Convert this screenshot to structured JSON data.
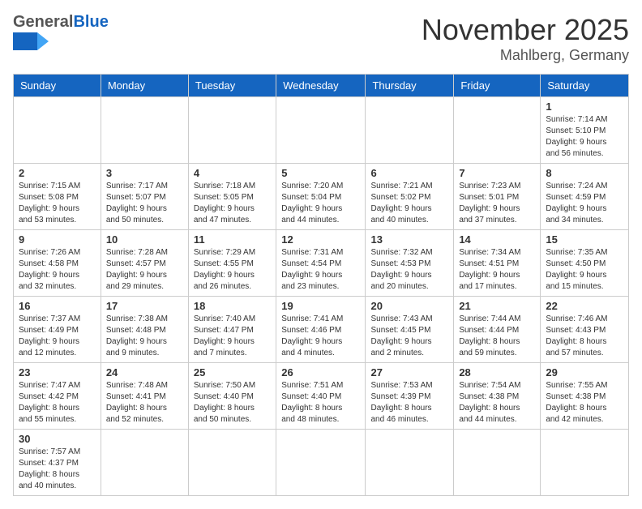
{
  "header": {
    "logo_general": "General",
    "logo_blue": "Blue",
    "main_title": "November 2025",
    "sub_title": "Mahlberg, Germany"
  },
  "days_of_week": [
    "Sunday",
    "Monday",
    "Tuesday",
    "Wednesday",
    "Thursday",
    "Friday",
    "Saturday"
  ],
  "weeks": [
    [
      {
        "day": "",
        "info": ""
      },
      {
        "day": "",
        "info": ""
      },
      {
        "day": "",
        "info": ""
      },
      {
        "day": "",
        "info": ""
      },
      {
        "day": "",
        "info": ""
      },
      {
        "day": "",
        "info": ""
      },
      {
        "day": "1",
        "info": "Sunrise: 7:14 AM\nSunset: 5:10 PM\nDaylight: 9 hours\nand 56 minutes."
      }
    ],
    [
      {
        "day": "2",
        "info": "Sunrise: 7:15 AM\nSunset: 5:08 PM\nDaylight: 9 hours\nand 53 minutes."
      },
      {
        "day": "3",
        "info": "Sunrise: 7:17 AM\nSunset: 5:07 PM\nDaylight: 9 hours\nand 50 minutes."
      },
      {
        "day": "4",
        "info": "Sunrise: 7:18 AM\nSunset: 5:05 PM\nDaylight: 9 hours\nand 47 minutes."
      },
      {
        "day": "5",
        "info": "Sunrise: 7:20 AM\nSunset: 5:04 PM\nDaylight: 9 hours\nand 44 minutes."
      },
      {
        "day": "6",
        "info": "Sunrise: 7:21 AM\nSunset: 5:02 PM\nDaylight: 9 hours\nand 40 minutes."
      },
      {
        "day": "7",
        "info": "Sunrise: 7:23 AM\nSunset: 5:01 PM\nDaylight: 9 hours\nand 37 minutes."
      },
      {
        "day": "8",
        "info": "Sunrise: 7:24 AM\nSunset: 4:59 PM\nDaylight: 9 hours\nand 34 minutes."
      }
    ],
    [
      {
        "day": "9",
        "info": "Sunrise: 7:26 AM\nSunset: 4:58 PM\nDaylight: 9 hours\nand 32 minutes."
      },
      {
        "day": "10",
        "info": "Sunrise: 7:28 AM\nSunset: 4:57 PM\nDaylight: 9 hours\nand 29 minutes."
      },
      {
        "day": "11",
        "info": "Sunrise: 7:29 AM\nSunset: 4:55 PM\nDaylight: 9 hours\nand 26 minutes."
      },
      {
        "day": "12",
        "info": "Sunrise: 7:31 AM\nSunset: 4:54 PM\nDaylight: 9 hours\nand 23 minutes."
      },
      {
        "day": "13",
        "info": "Sunrise: 7:32 AM\nSunset: 4:53 PM\nDaylight: 9 hours\nand 20 minutes."
      },
      {
        "day": "14",
        "info": "Sunrise: 7:34 AM\nSunset: 4:51 PM\nDaylight: 9 hours\nand 17 minutes."
      },
      {
        "day": "15",
        "info": "Sunrise: 7:35 AM\nSunset: 4:50 PM\nDaylight: 9 hours\nand 15 minutes."
      }
    ],
    [
      {
        "day": "16",
        "info": "Sunrise: 7:37 AM\nSunset: 4:49 PM\nDaylight: 9 hours\nand 12 minutes."
      },
      {
        "day": "17",
        "info": "Sunrise: 7:38 AM\nSunset: 4:48 PM\nDaylight: 9 hours\nand 9 minutes."
      },
      {
        "day": "18",
        "info": "Sunrise: 7:40 AM\nSunset: 4:47 PM\nDaylight: 9 hours\nand 7 minutes."
      },
      {
        "day": "19",
        "info": "Sunrise: 7:41 AM\nSunset: 4:46 PM\nDaylight: 9 hours\nand 4 minutes."
      },
      {
        "day": "20",
        "info": "Sunrise: 7:43 AM\nSunset: 4:45 PM\nDaylight: 9 hours\nand 2 minutes."
      },
      {
        "day": "21",
        "info": "Sunrise: 7:44 AM\nSunset: 4:44 PM\nDaylight: 8 hours\nand 59 minutes."
      },
      {
        "day": "22",
        "info": "Sunrise: 7:46 AM\nSunset: 4:43 PM\nDaylight: 8 hours\nand 57 minutes."
      }
    ],
    [
      {
        "day": "23",
        "info": "Sunrise: 7:47 AM\nSunset: 4:42 PM\nDaylight: 8 hours\nand 55 minutes."
      },
      {
        "day": "24",
        "info": "Sunrise: 7:48 AM\nSunset: 4:41 PM\nDaylight: 8 hours\nand 52 minutes."
      },
      {
        "day": "25",
        "info": "Sunrise: 7:50 AM\nSunset: 4:40 PM\nDaylight: 8 hours\nand 50 minutes."
      },
      {
        "day": "26",
        "info": "Sunrise: 7:51 AM\nSunset: 4:40 PM\nDaylight: 8 hours\nand 48 minutes."
      },
      {
        "day": "27",
        "info": "Sunrise: 7:53 AM\nSunset: 4:39 PM\nDaylight: 8 hours\nand 46 minutes."
      },
      {
        "day": "28",
        "info": "Sunrise: 7:54 AM\nSunset: 4:38 PM\nDaylight: 8 hours\nand 44 minutes."
      },
      {
        "day": "29",
        "info": "Sunrise: 7:55 AM\nSunset: 4:38 PM\nDaylight: 8 hours\nand 42 minutes."
      }
    ],
    [
      {
        "day": "30",
        "info": "Sunrise: 7:57 AM\nSunset: 4:37 PM\nDaylight: 8 hours\nand 40 minutes."
      },
      {
        "day": "",
        "info": ""
      },
      {
        "day": "",
        "info": ""
      },
      {
        "day": "",
        "info": ""
      },
      {
        "day": "",
        "info": ""
      },
      {
        "day": "",
        "info": ""
      },
      {
        "day": "",
        "info": ""
      }
    ]
  ]
}
